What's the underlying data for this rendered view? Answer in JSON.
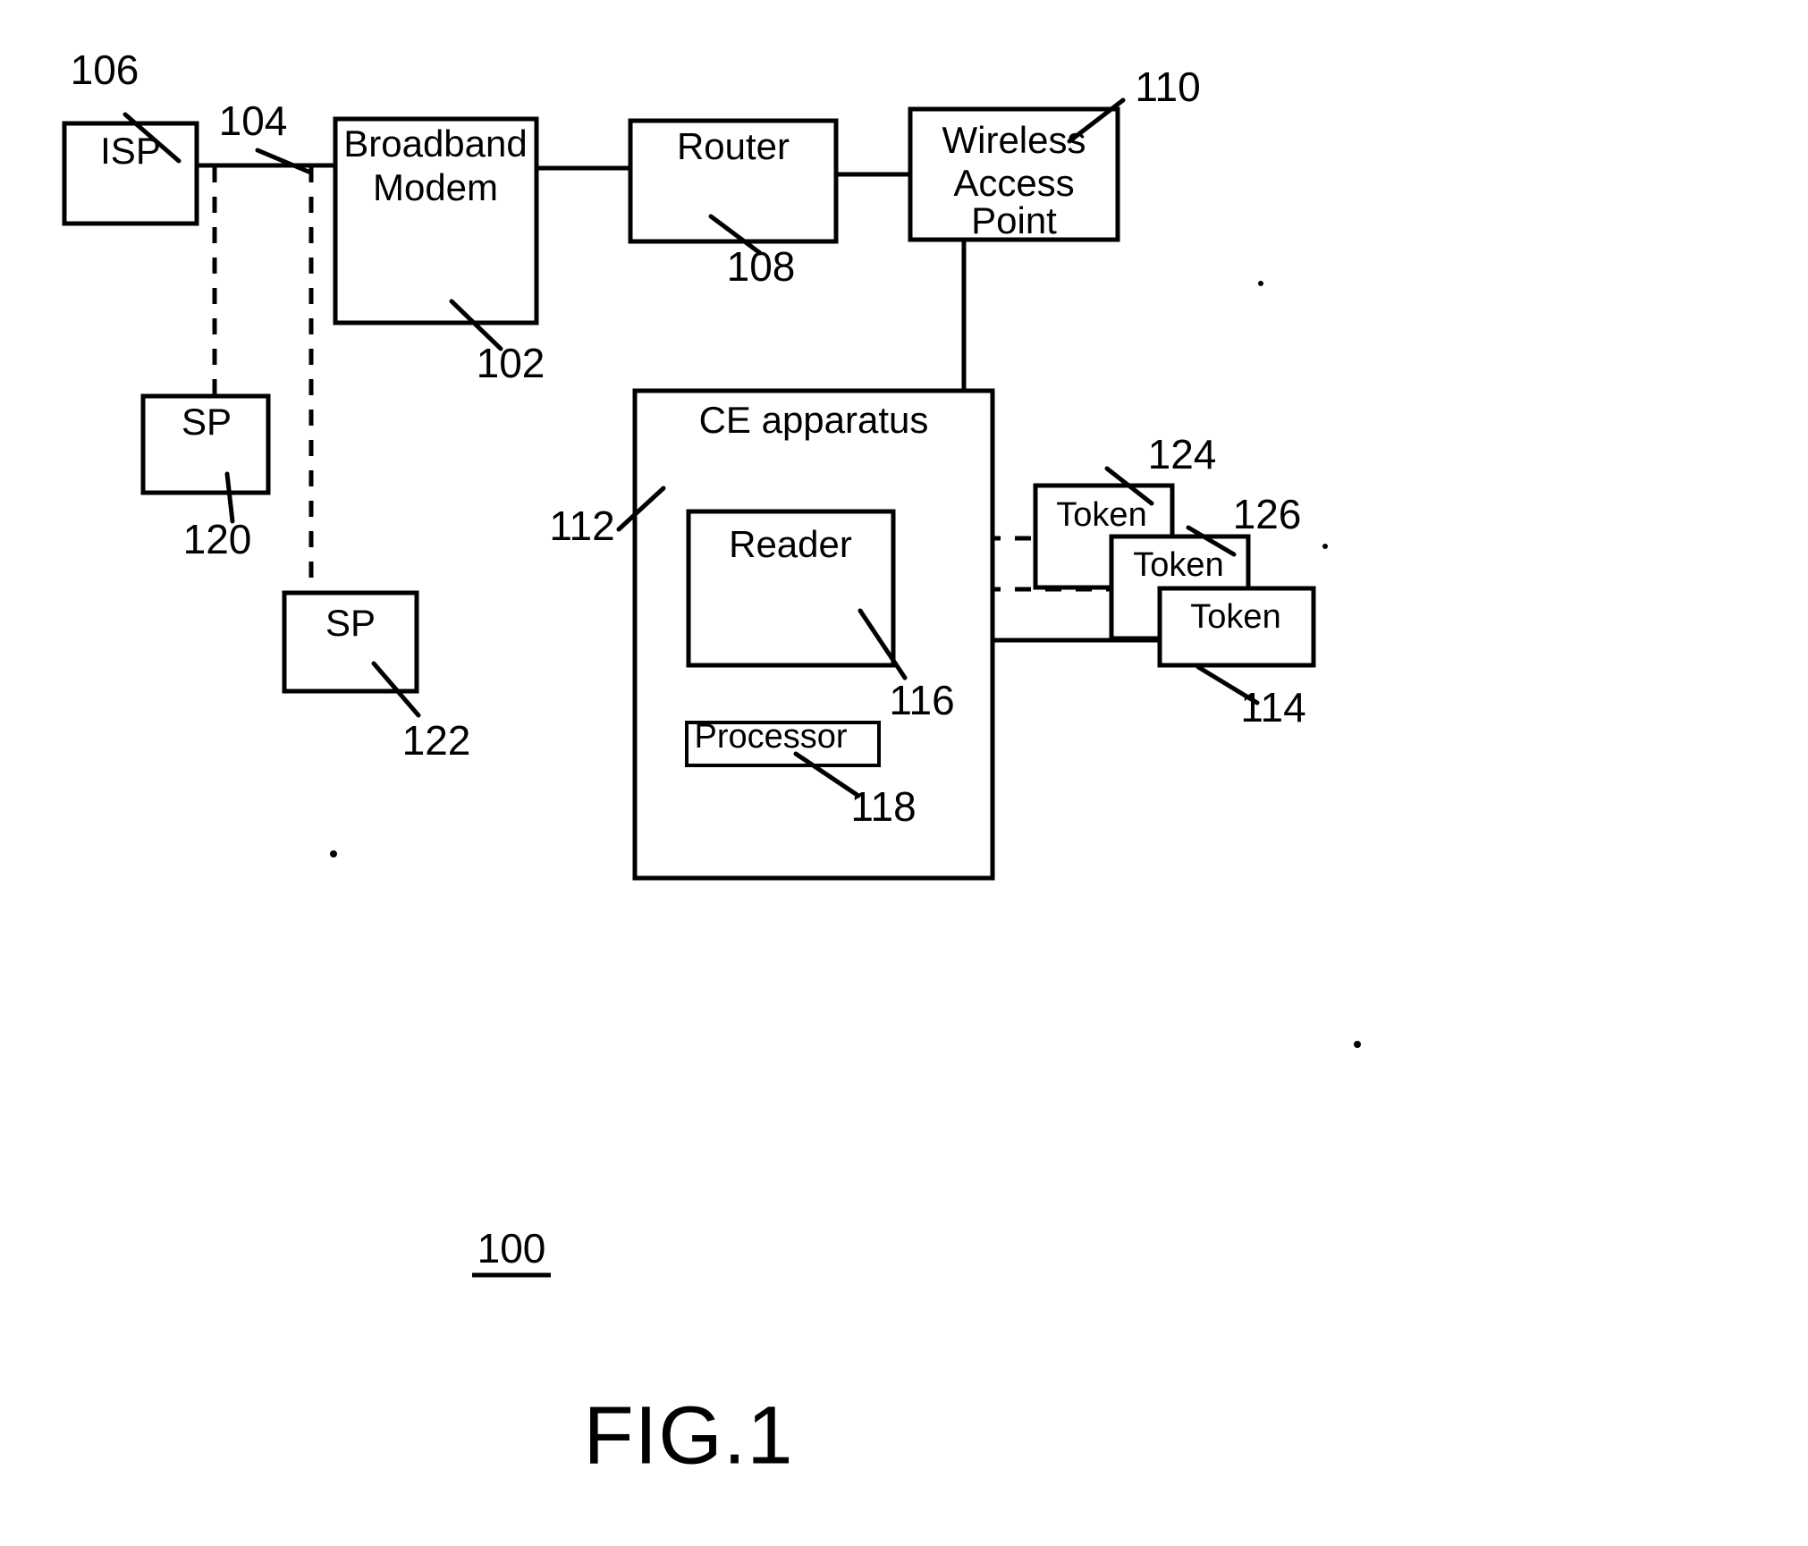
{
  "figure": {
    "caption": "FIG.1",
    "system_ref": "100"
  },
  "blocks": [
    {
      "id": "isp",
      "label": "ISP",
      "ref": "106"
    },
    {
      "id": "modem",
      "label_line1": "Broadband",
      "label_line2": "Modem",
      "ref": "102"
    },
    {
      "id": "router",
      "label": "Router",
      "ref": "108"
    },
    {
      "id": "wap",
      "label_line1": "Wireless",
      "label_line2": "Access",
      "label_line3": "Point",
      "ref": "110"
    },
    {
      "id": "sp1",
      "label": "SP",
      "ref": "120"
    },
    {
      "id": "sp2",
      "label": "SP",
      "ref": "122"
    },
    {
      "id": "ce",
      "label": "CE apparatus",
      "ref": "112"
    },
    {
      "id": "reader",
      "label": "Reader",
      "ref": "116"
    },
    {
      "id": "processor",
      "label": "Processor",
      "ref": "118"
    },
    {
      "id": "token1",
      "label": "Token",
      "ref": "124"
    },
    {
      "id": "token2",
      "label": "Token",
      "ref": "126"
    },
    {
      "id": "token3",
      "label": "Token",
      "ref": "114"
    }
  ],
  "connections": [
    {
      "id": "isp-modem",
      "ref": "104",
      "style": "solid"
    },
    {
      "id": "modem-router",
      "ref": "",
      "style": "solid"
    },
    {
      "id": "router-wap",
      "ref": "",
      "style": "solid"
    },
    {
      "id": "wap-ce",
      "ref": "",
      "style": "solid"
    },
    {
      "id": "link-sp1",
      "ref": "",
      "style": "dashed"
    },
    {
      "id": "link-sp2",
      "ref": "",
      "style": "dashed"
    },
    {
      "id": "reader-token1",
      "ref": "",
      "style": "dashed"
    },
    {
      "id": "reader-token2",
      "ref": "",
      "style": "dashed"
    },
    {
      "id": "reader-token3",
      "ref": "",
      "style": "solid"
    }
  ]
}
